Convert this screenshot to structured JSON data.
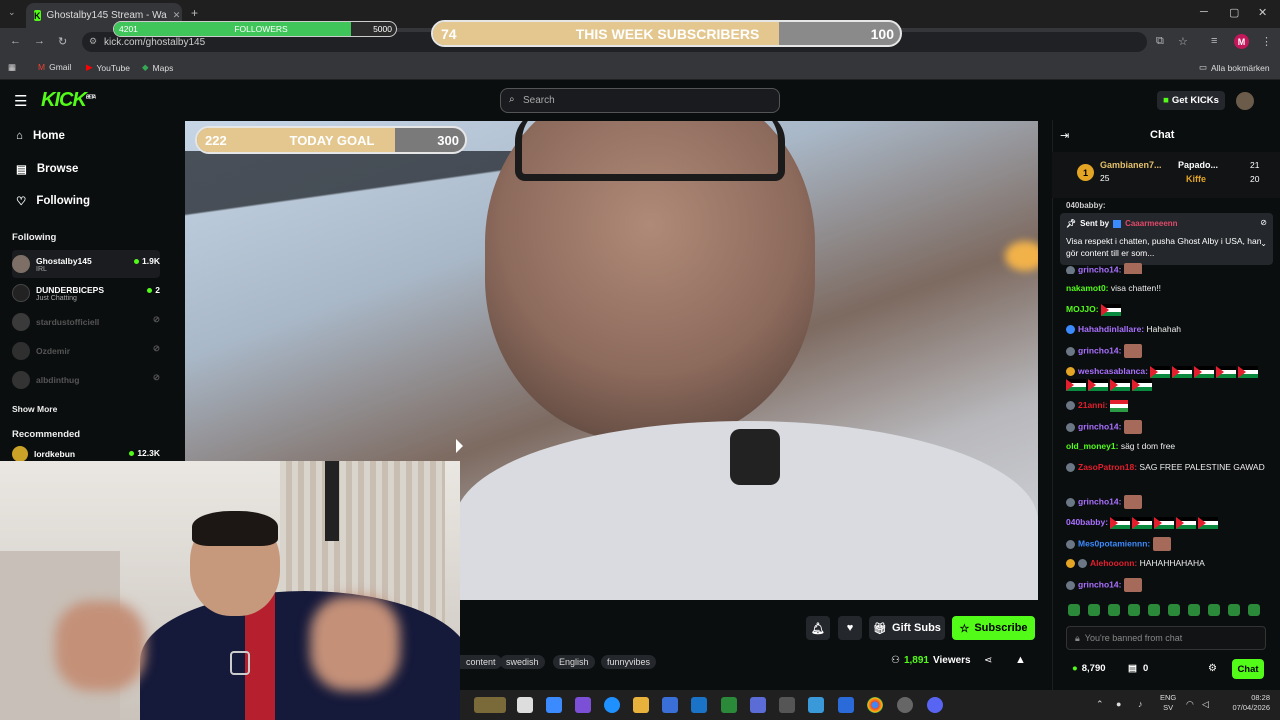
{
  "browser": {
    "tab_title": "Ghostalby145 Stream - Wa",
    "url": "kick.com/ghostalby145",
    "bookmarks": [
      "Gmail",
      "YouTube",
      "Maps"
    ],
    "all_bookmarks": "Alla bokmärken",
    "profile_initial": "M"
  },
  "overlays": {
    "followers": {
      "current": "4201",
      "label": "FOLLOWERS",
      "goal": "5000",
      "progress": 0.84
    },
    "week_subs": {
      "current": "74",
      "label": "THIS WEEK SUBSCRIBERS",
      "goal": "100",
      "progress": 0.74
    },
    "today_goal": {
      "current": "222",
      "label": "TODAY GOAL",
      "goal": "300",
      "progress": 0.74
    }
  },
  "header": {
    "logo": "KICK",
    "logo_badge": "BETA",
    "search_placeholder": "Search",
    "get_kicks": "Get KICKs"
  },
  "sidebar": {
    "nav": [
      {
        "label": "Home",
        "icon": "home-icon"
      },
      {
        "label": "Browse",
        "icon": "browse-icon"
      },
      {
        "label": "Following",
        "icon": "heart-icon"
      }
    ],
    "following_heading": "Following",
    "following": [
      {
        "name": "Ghostalby145",
        "sub": "IRL",
        "count": "1.9K",
        "live": true
      },
      {
        "name": "DUNDERBICEPS",
        "sub": "Just Chatting",
        "count": "2",
        "live": true
      },
      {
        "name": "stardustofficiell",
        "sub": "",
        "count": "",
        "live": false
      },
      {
        "name": "Ozdemir",
        "sub": "",
        "count": "",
        "live": false
      },
      {
        "name": "albdinthug",
        "sub": "",
        "count": "",
        "live": false
      }
    ],
    "show_more": "Show More",
    "recommended_heading": "Recommended",
    "recommended": [
      {
        "name": "lordkebun",
        "count": "12.3K"
      }
    ]
  },
  "stream": {
    "gift_subs": "Gift Subs",
    "subscribe": "Subscribe",
    "tags": [
      "content",
      "swedish",
      "English",
      "funnyvibes"
    ],
    "viewers": "1,891",
    "viewers_label": "Viewers"
  },
  "chat": {
    "title": "Chat",
    "leaderboard": [
      {
        "rank": "1",
        "name": "Gambianen7...",
        "value": "25"
      },
      {
        "name": "Papado...",
        "value": "21"
      },
      {
        "name": "Kiffe",
        "value": "20"
      }
    ],
    "truncated_user": "040babby:",
    "pinned": {
      "sent_by": "Sent by",
      "user": "Caaarmeeenn",
      "text": "Visa respekt i chatten, pusha Ghost Alby i USA, han gör content till er som..."
    },
    "messages": [
      {
        "user": "grincho14:",
        "color": "#a970ff",
        "text": "",
        "emote": "face"
      },
      {
        "user": "nakamot0:",
        "color": "#53fc18",
        "text": "visa chatten!!",
        "emote": ""
      },
      {
        "user": "MOJJO:",
        "color": "#53fc18",
        "text": "",
        "emote": "flag1"
      },
      {
        "user": "Hahahdinlallare:",
        "color": "#a970ff",
        "text": "Hahahah",
        "emote": ""
      },
      {
        "user": "grincho14:",
        "color": "#a970ff",
        "text": "",
        "emote": "face"
      },
      {
        "user": "weshcasablanca:",
        "color": "#a970ff",
        "text": "",
        "emote": "flags"
      },
      {
        "user": "21anni:",
        "color": "#e31e2d",
        "text": "",
        "emote": "kurd"
      },
      {
        "user": "grincho14:",
        "color": "#a970ff",
        "text": "",
        "emote": "face"
      },
      {
        "user": "old_money1:",
        "color": "#53fc18",
        "text": "säg t dom free",
        "emote": ""
      },
      {
        "user": "ZasoPatron18:",
        "color": "#e31e2d",
        "text": "SAG FREE PALESTINE GAWAD",
        "emote": ""
      },
      {
        "user": "grincho14:",
        "color": "#a970ff",
        "text": "",
        "emote": "face"
      },
      {
        "user": "040babby:",
        "color": "#a970ff",
        "text": "",
        "emote": "flags5"
      },
      {
        "user": "Mes0potamiennn:",
        "color": "#3b8bff",
        "text": "",
        "emote": "face"
      },
      {
        "user": "Alehooonn:",
        "color": "#e31e2d",
        "text": "HAHAHHAHAHA",
        "emote": ""
      },
      {
        "user": "grincho14:",
        "color": "#a970ff",
        "text": "",
        "emote": "face"
      }
    ],
    "banned": "You're banned from chat",
    "kicks_balance": "8,790",
    "gift_count": "0",
    "chat_button": "Chat"
  },
  "taskbar": {
    "lang": "ENG",
    "lang_sub": "SV",
    "time": "08:28",
    "date": "07/04/2026"
  }
}
